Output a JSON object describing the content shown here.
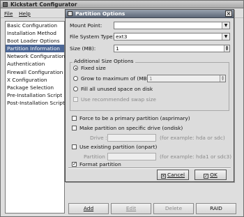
{
  "window": {
    "title": "Kickstart Configurator"
  },
  "menu": {
    "file": "File",
    "help": "Help"
  },
  "sidebar": {
    "items": [
      {
        "label": "Basic Configuration"
      },
      {
        "label": "Installation Method"
      },
      {
        "label": "Boot Loader Options"
      },
      {
        "label": "Partition Information"
      },
      {
        "label": "Network Configuration"
      },
      {
        "label": "Authentication"
      },
      {
        "label": "Firewall Configuration"
      },
      {
        "label": "X Configuration"
      },
      {
        "label": "Package Selection"
      },
      {
        "label": "Pre-Installation Script"
      },
      {
        "label": "Post-Installation Script"
      }
    ],
    "selected_index": 3
  },
  "bottom_buttons": {
    "add": "Add",
    "edit": "Edit",
    "delete": "Delete",
    "raid": "RAID"
  },
  "dialog": {
    "title": "Partition Options",
    "mount_point": {
      "label": "Mount Point:",
      "value": ""
    },
    "fs_type": {
      "label": "File System Type:",
      "value": "ext3"
    },
    "size": {
      "label": "Size (MB):",
      "value": "1"
    },
    "additional": {
      "title": "Additional Size Options",
      "fixed": "Fixed size",
      "grow": "Grow to maximum of (MB):",
      "grow_value": "1",
      "fill": "Fill all unused space on disk",
      "swap": "Use recommended swap size",
      "selected": "fixed"
    },
    "primary": "Force to be a primary partition (asprimary)",
    "ondisk": "Make partition on specific drive (ondisk)",
    "drive_label": "Drive :",
    "drive_example": "(for example: hda or sdc)",
    "onpart": "Use existing partition (onpart)",
    "partition_label": "Partition :",
    "partition_example": "(for example: hda1 or sdc3)",
    "format": "Format partition",
    "format_checked": true,
    "cancel": "Cancel",
    "ok": "OK"
  }
}
